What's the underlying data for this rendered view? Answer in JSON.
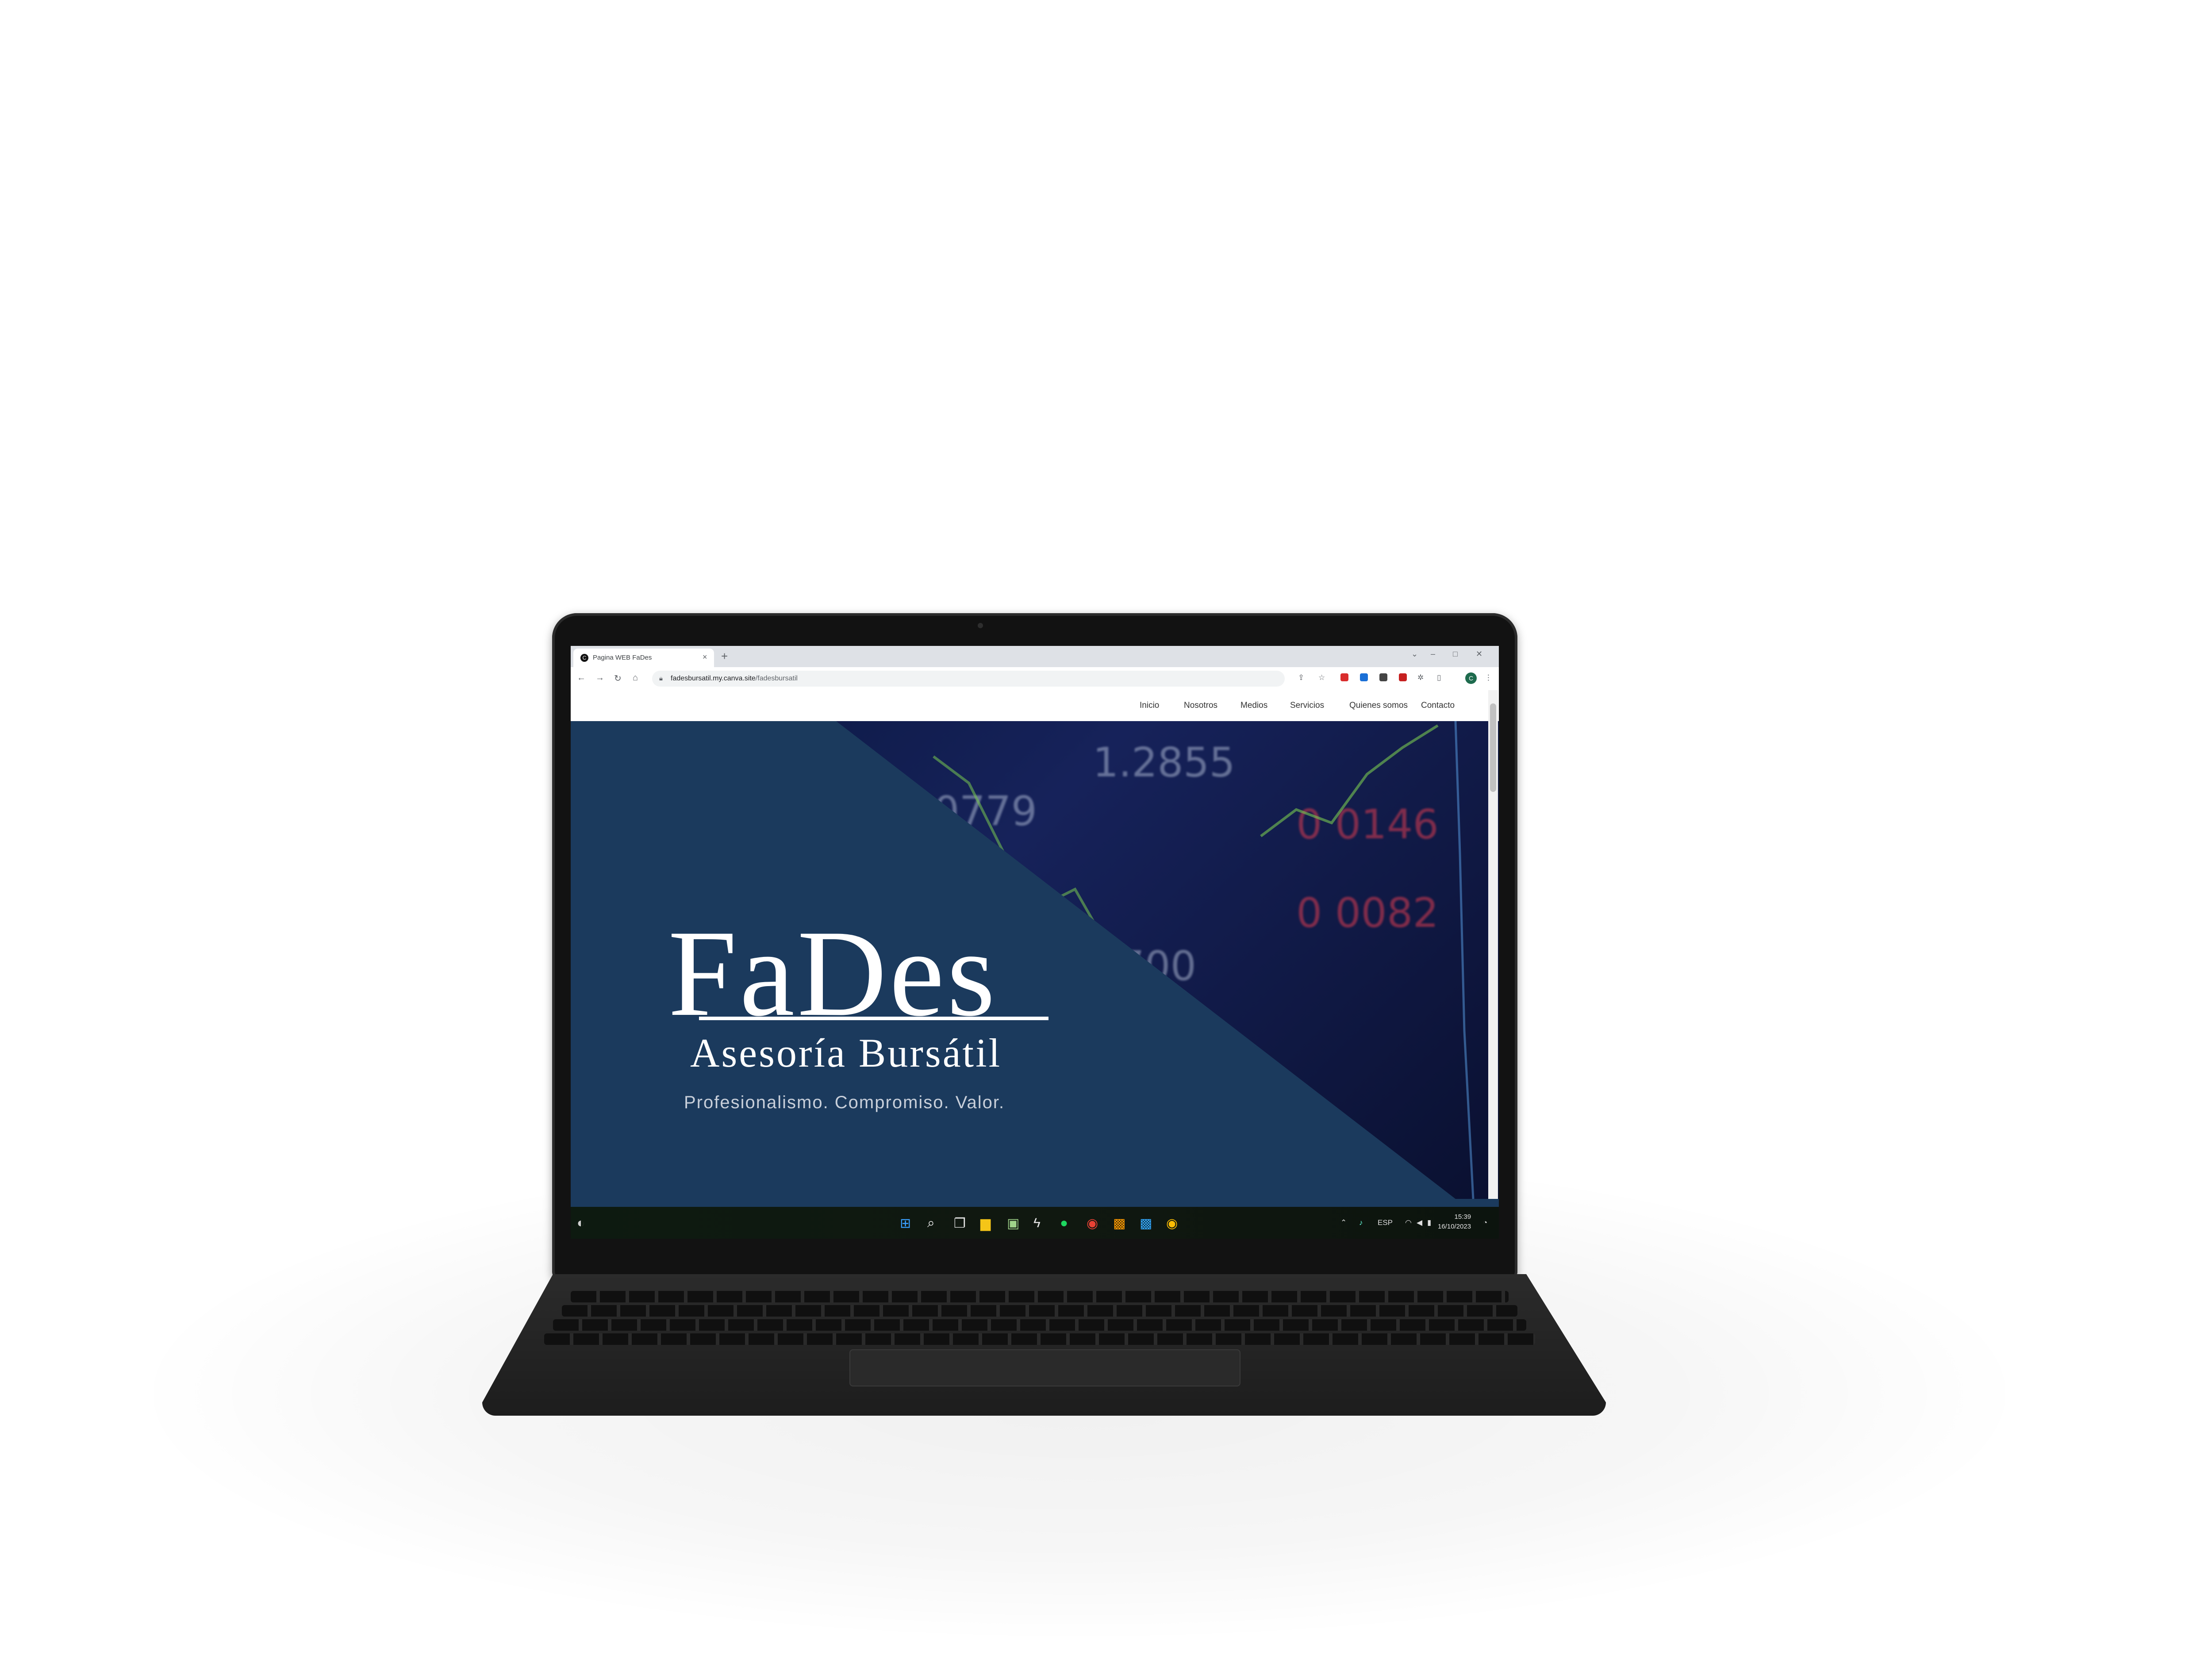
{
  "browser": {
    "tab_title": "Pagina WEB FaDes",
    "tab_close": "×",
    "new_tab": "+",
    "url_host": "fadesbursatil.my.canva.site",
    "url_path": "/fadesbursatil",
    "profile_initial": "C"
  },
  "site_nav": {
    "items": [
      "Inicio",
      "Nosotros",
      "Medios",
      "Servicios",
      "Quienes somos",
      "Contacto"
    ]
  },
  "hero": {
    "logo_word": "FaDes",
    "logo_sub": "Asesoría Bursátil",
    "tagline": "Profesionalismo. Compromiso. Valor.",
    "background_numbers": [
      "1.2855",
      "0779",
      "0 0146",
      "0 0082",
      "1700"
    ]
  },
  "taskbar": {
    "lang": "ESP",
    "time": "15:39",
    "date": "16/10/2023"
  },
  "colors": {
    "hero_bg": "#1b3a5d",
    "photo_bg": "#16225a",
    "profile": "#1e6b4e"
  }
}
